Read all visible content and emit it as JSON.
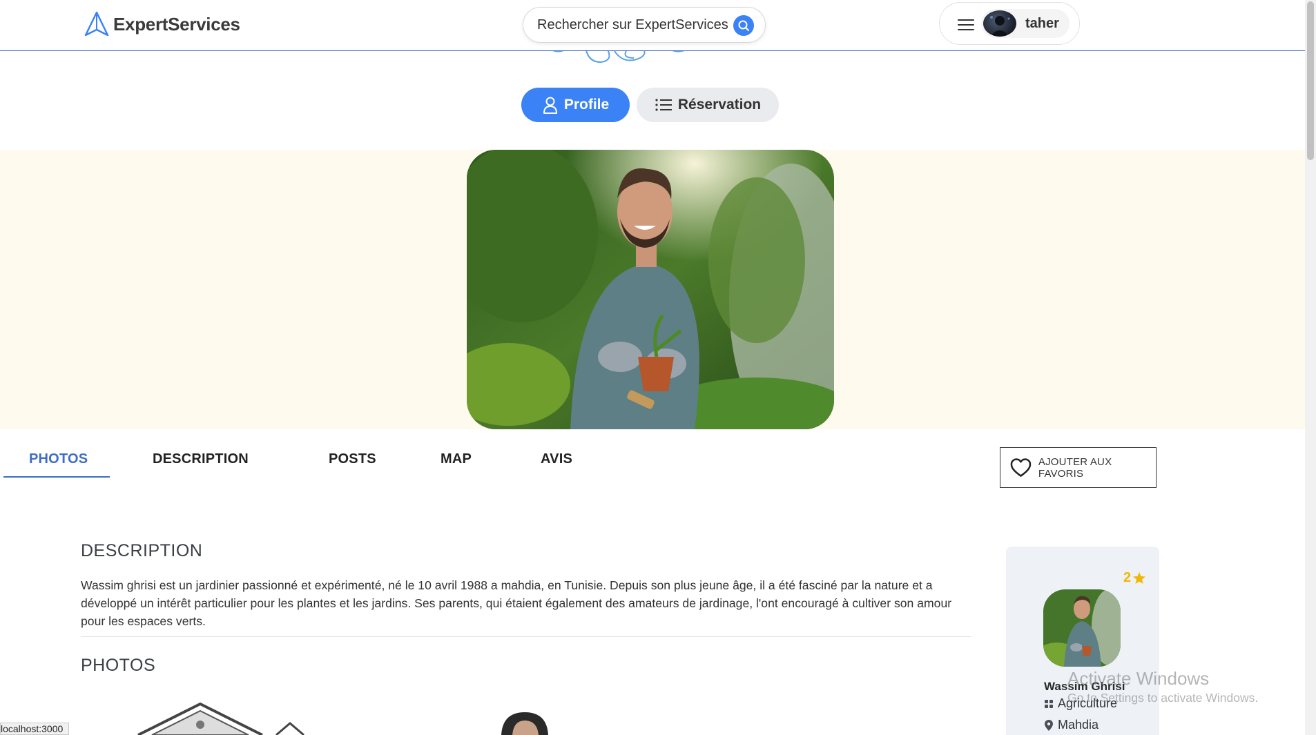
{
  "header": {
    "brand": "ExpertServices",
    "search_placeholder": "Rechercher sur ExpertServices",
    "user_name": "taher"
  },
  "toggle": {
    "profile_label": "Profile",
    "reservation_label": "Réservation"
  },
  "tabs": [
    "PHOTOS",
    "DESCRIPTION",
    "POSTS",
    "MAP",
    "AVIS"
  ],
  "active_tab": "PHOTOS",
  "favorite_label": "AJOUTER AUX FAVORIS",
  "description": {
    "title": "DESCRIPTION",
    "text": "Wassim ghrisi est un jardinier passionné et expérimenté, né le 10 avril 1988 a mahdia, en Tunisie. Depuis son plus jeune âge, il a été fasciné par la nature et a développé un intérêt particulier pour les plantes et les jardins. Ses parents, qui étaient également des amateurs de jardinage, l'ont encouragé à cultiver son amour pour les espaces verts."
  },
  "photos": {
    "title": "PHOTOS"
  },
  "profile_card": {
    "rating": "2",
    "name": "Wassim Ghrisi",
    "category": "Agriculture",
    "location": "Mahdia"
  },
  "watermark": {
    "line1": "Activate Windows",
    "line2": "Go to Settings to activate Windows."
  },
  "status_url": "localhost:3000",
  "colors": {
    "accent": "#3b82f6",
    "tab_active": "#3f6cc8",
    "hero_bg": "#fffaee",
    "star": "#f2b705"
  }
}
